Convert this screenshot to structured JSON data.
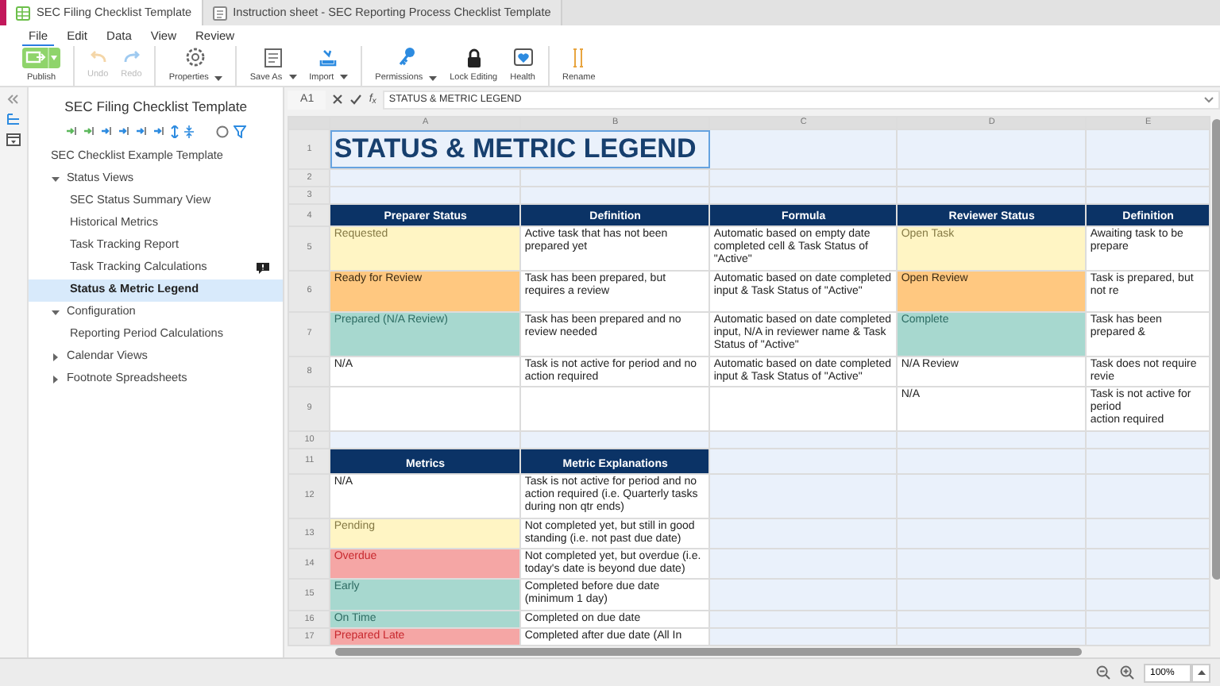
{
  "tabs": [
    {
      "label": "SEC Filing Checklist Template",
      "selected": true
    },
    {
      "label": "Instruction sheet - SEC Reporting Process Checklist Template",
      "selected": false
    }
  ],
  "menu": [
    {
      "label": "File",
      "selected": true
    },
    {
      "label": "Edit",
      "selected": false
    },
    {
      "label": "Data",
      "selected": false
    },
    {
      "label": "View",
      "selected": false
    },
    {
      "label": "Review",
      "selected": false
    }
  ],
  "toolbar": [
    {
      "label": "Publish",
      "kind": "split",
      "disabled": false,
      "dropdown": true,
      "separator_before": false
    },
    {
      "label": "Undo",
      "kind": "tool",
      "disabled": true,
      "dropdown": false,
      "separator_before": true
    },
    {
      "label": "Redo",
      "kind": "tool",
      "disabled": true,
      "dropdown": false,
      "separator_before": false
    },
    {
      "label": "Properties",
      "kind": "tool",
      "disabled": false,
      "dropdown": true,
      "separator_before": true
    },
    {
      "label": "Save As",
      "kind": "tool",
      "disabled": false,
      "dropdown": true,
      "separator_before": true
    },
    {
      "label": "Import",
      "kind": "tool",
      "disabled": false,
      "dropdown": true,
      "separator_before": false
    },
    {
      "label": "Permissions",
      "kind": "tool",
      "disabled": false,
      "dropdown": true,
      "separator_before": true
    },
    {
      "label": "Lock Editing",
      "kind": "tool",
      "disabled": false,
      "dropdown": false,
      "separator_before": false
    },
    {
      "label": "Health",
      "kind": "tool",
      "disabled": false,
      "dropdown": false,
      "separator_before": false
    },
    {
      "label": "Rename",
      "kind": "tool",
      "disabled": false,
      "dropdown": false,
      "separator_before": true
    }
  ],
  "sidebar": {
    "title": "SEC Filing Checklist Template",
    "tree": [
      {
        "label": "SEC Checklist Example Template",
        "selected": false,
        "comment": false
      },
      {
        "label": "Status Views",
        "expanded": true,
        "selected": false,
        "comment": false,
        "children": [
          {
            "label": "SEC Status Summary View",
            "selected": false,
            "comment": false
          },
          {
            "label": "Historical Metrics",
            "selected": false,
            "comment": false
          },
          {
            "label": "Task Tracking Report",
            "selected": false,
            "comment": false
          },
          {
            "label": "Task Tracking Calculations",
            "selected": false,
            "comment": true
          },
          {
            "label": "Status & Metric Legend",
            "selected": true,
            "comment": false
          }
        ]
      },
      {
        "label": "Configuration",
        "expanded": true,
        "selected": false,
        "comment": false,
        "children": [
          {
            "label": "Reporting Period Calculations",
            "selected": false,
            "comment": false
          }
        ]
      },
      {
        "label": "Calendar Views",
        "expanded": false,
        "selected": false,
        "comment": false
      },
      {
        "label": "Footnote Spreadsheets",
        "expanded": false,
        "selected": false,
        "comment": false
      }
    ]
  },
  "formula_bar": {
    "name_box": "A1",
    "function_label": "f$_{x}$",
    "formula": "STATUS & METRIC LEGEND"
  },
  "sheet": {
    "columns": [
      "A",
      "B",
      "C",
      "D",
      "E"
    ],
    "rows": [
      {
        "number": "1",
        "cells": [
          {
            "kind": "title",
            "text": "STATUS & METRIC LEGEND",
            "colspan": 2,
            "selected": true
          },
          {
            "kind": "blank",
            "selected": false
          },
          {
            "kind": "blank",
            "selected": false
          },
          {
            "kind": "blank",
            "selected": false
          }
        ]
      },
      {
        "number": "2",
        "cells": [
          {
            "kind": "blank",
            "selected": false
          },
          {
            "kind": "blank",
            "selected": false
          },
          {
            "kind": "blank",
            "selected": false
          },
          {
            "kind": "blank",
            "selected": false
          },
          {
            "kind": "blank",
            "selected": false
          }
        ]
      },
      {
        "number": "3",
        "cells": [
          {
            "kind": "blank",
            "selected": false
          },
          {
            "kind": "blank",
            "selected": false
          },
          {
            "kind": "blank",
            "selected": false
          },
          {
            "kind": "blank",
            "selected": false
          },
          {
            "kind": "blank",
            "selected": false
          }
        ]
      },
      {
        "number": "4",
        "cells": [
          {
            "kind": "header",
            "text": "Preparer Status",
            "selected": false
          },
          {
            "kind": "header",
            "text": "Definition",
            "selected": false
          },
          {
            "kind": "header",
            "text": "Formula",
            "selected": false
          },
          {
            "kind": "header",
            "text": "Reviewer Status",
            "selected": false
          },
          {
            "kind": "header",
            "text": "Definition",
            "selected": false
          }
        ]
      },
      {
        "number": "5",
        "cells": [
          {
            "kind": "text",
            "text": "Requested",
            "color": "#fff5c4",
            "selected": false
          },
          {
            "kind": "text",
            "text": "Active task that has not been prepared yet",
            "selected": false
          },
          {
            "kind": "text",
            "text": "Automatic based on empty date completed cell & Task Status of \"Active\"",
            "selected": false
          },
          {
            "kind": "text",
            "text": "Open Task",
            "color": "#fff5c4",
            "selected": false
          },
          {
            "kind": "text",
            "text": "Awaiting task to be prepare",
            "selected": false
          }
        ]
      },
      {
        "number": "6",
        "cells": [
          {
            "kind": "text",
            "text": "Ready for Review",
            "color": "#ffc880",
            "selected": false
          },
          {
            "kind": "text",
            "text": "Task has been prepared, but requires a review",
            "selected": false
          },
          {
            "kind": "text",
            "text": "Automatic based on date completed input & Task Status of \"Active\"",
            "selected": false
          },
          {
            "kind": "text",
            "text": "Open Review",
            "color": "#ffc880",
            "selected": false
          },
          {
            "kind": "text",
            "text": "Task is prepared, but not re",
            "selected": false
          }
        ]
      },
      {
        "number": "7",
        "cells": [
          {
            "kind": "text",
            "text": "Prepared (N/A Review)",
            "color": "#a7d8cf",
            "selected": false
          },
          {
            "kind": "text",
            "text": "Task has been prepared and no review needed",
            "selected": false
          },
          {
            "kind": "text",
            "text": "Automatic based on date completed input, N/A in reviewer name & Task Status of \"Active\"",
            "selected": false
          },
          {
            "kind": "text",
            "text": "Complete",
            "color": "#a7d8cf",
            "selected": false
          },
          {
            "kind": "text",
            "text": "Task has been prepared &",
            "selected": false
          }
        ]
      },
      {
        "number": "8",
        "cells": [
          {
            "kind": "text",
            "text": "N/A",
            "selected": false
          },
          {
            "kind": "text",
            "text": "Task is not active for period and no action required",
            "selected": false
          },
          {
            "kind": "text",
            "text": "Automatic based on date completed input & Task Status of \"Active\"",
            "selected": false
          },
          {
            "kind": "text",
            "text": "N/A Review",
            "selected": false
          },
          {
            "kind": "text",
            "text": "Task does not require revie",
            "selected": false
          }
        ]
      },
      {
        "number": "9",
        "cells": [
          {
            "kind": "empty",
            "selected": false
          },
          {
            "kind": "empty",
            "selected": false
          },
          {
            "kind": "empty",
            "selected": false
          },
          {
            "kind": "text",
            "text": "N/A",
            "selected": false
          },
          {
            "kind": "text",
            "text": "Task is not active for period\naction required",
            "selected": false
          }
        ]
      },
      {
        "number": "10",
        "cells": [
          {
            "kind": "blank",
            "selected": false
          },
          {
            "kind": "blank",
            "selected": false
          },
          {
            "kind": "blank",
            "selected": false
          },
          {
            "kind": "blank",
            "selected": false
          },
          {
            "kind": "blank",
            "selected": false
          }
        ]
      },
      {
        "number": "11",
        "cells": [
          {
            "kind": "header",
            "text": "Metrics",
            "selected": false
          },
          {
            "kind": "header",
            "text": "Metric Explanations",
            "selected": false
          },
          {
            "kind": "blank",
            "selected": false
          },
          {
            "kind": "blank",
            "selected": false
          },
          {
            "kind": "blank",
            "selected": false
          }
        ]
      },
      {
        "number": "12",
        "cells": [
          {
            "kind": "text",
            "text": "N/A",
            "selected": false
          },
          {
            "kind": "text",
            "text": "Task is not active for period and no action required (i.e. Quarterly tasks during non qtr ends)",
            "selected": false
          },
          {
            "kind": "blank",
            "selected": false
          },
          {
            "kind": "blank",
            "selected": false
          },
          {
            "kind": "blank",
            "selected": false
          }
        ]
      },
      {
        "number": "13",
        "cells": [
          {
            "kind": "text",
            "text": "Pending",
            "color": "#fff5c4",
            "selected": false
          },
          {
            "kind": "text",
            "text": "Not completed yet, but still in good standing (i.e. not past due date)",
            "selected": false
          },
          {
            "kind": "blank",
            "selected": false
          },
          {
            "kind": "blank",
            "selected": false
          },
          {
            "kind": "blank",
            "selected": false
          }
        ]
      },
      {
        "number": "14",
        "cells": [
          {
            "kind": "text",
            "text": "Overdue",
            "color": "#f5a6a5",
            "selected": false
          },
          {
            "kind": "text",
            "text": "Not completed yet, but overdue (i.e. today's date is beyond due date)",
            "selected": false
          },
          {
            "kind": "blank",
            "selected": false
          },
          {
            "kind": "blank",
            "selected": false
          },
          {
            "kind": "blank",
            "selected": false
          }
        ]
      },
      {
        "number": "15",
        "cells": [
          {
            "kind": "text",
            "text": "Early",
            "color": "#a7d8cf",
            "selected": false
          },
          {
            "kind": "text",
            "text": "Completed before due date (minimum 1 day)",
            "selected": false
          },
          {
            "kind": "blank",
            "selected": false
          },
          {
            "kind": "blank",
            "selected": false
          },
          {
            "kind": "blank",
            "selected": false
          }
        ]
      },
      {
        "number": "16",
        "cells": [
          {
            "kind": "text",
            "text": "On Time",
            "color": "#a7d8cf",
            "selected": false
          },
          {
            "kind": "text",
            "text": "Completed on due date",
            "selected": false
          },
          {
            "kind": "blank",
            "selected": false
          },
          {
            "kind": "blank",
            "selected": false
          },
          {
            "kind": "blank",
            "selected": false
          }
        ]
      },
      {
        "number": "17",
        "cells": [
          {
            "kind": "text",
            "text": "Prepared Late",
            "color": "#f5a6a5",
            "selected": false
          },
          {
            "kind": "text",
            "text": "Completed after due date (All In",
            "selected": false
          },
          {
            "kind": "blank",
            "selected": false
          },
          {
            "kind": "blank",
            "selected": false
          },
          {
            "kind": "blank",
            "selected": false
          }
        ]
      }
    ]
  },
  "status_bar": {
    "zoom": "100%"
  }
}
